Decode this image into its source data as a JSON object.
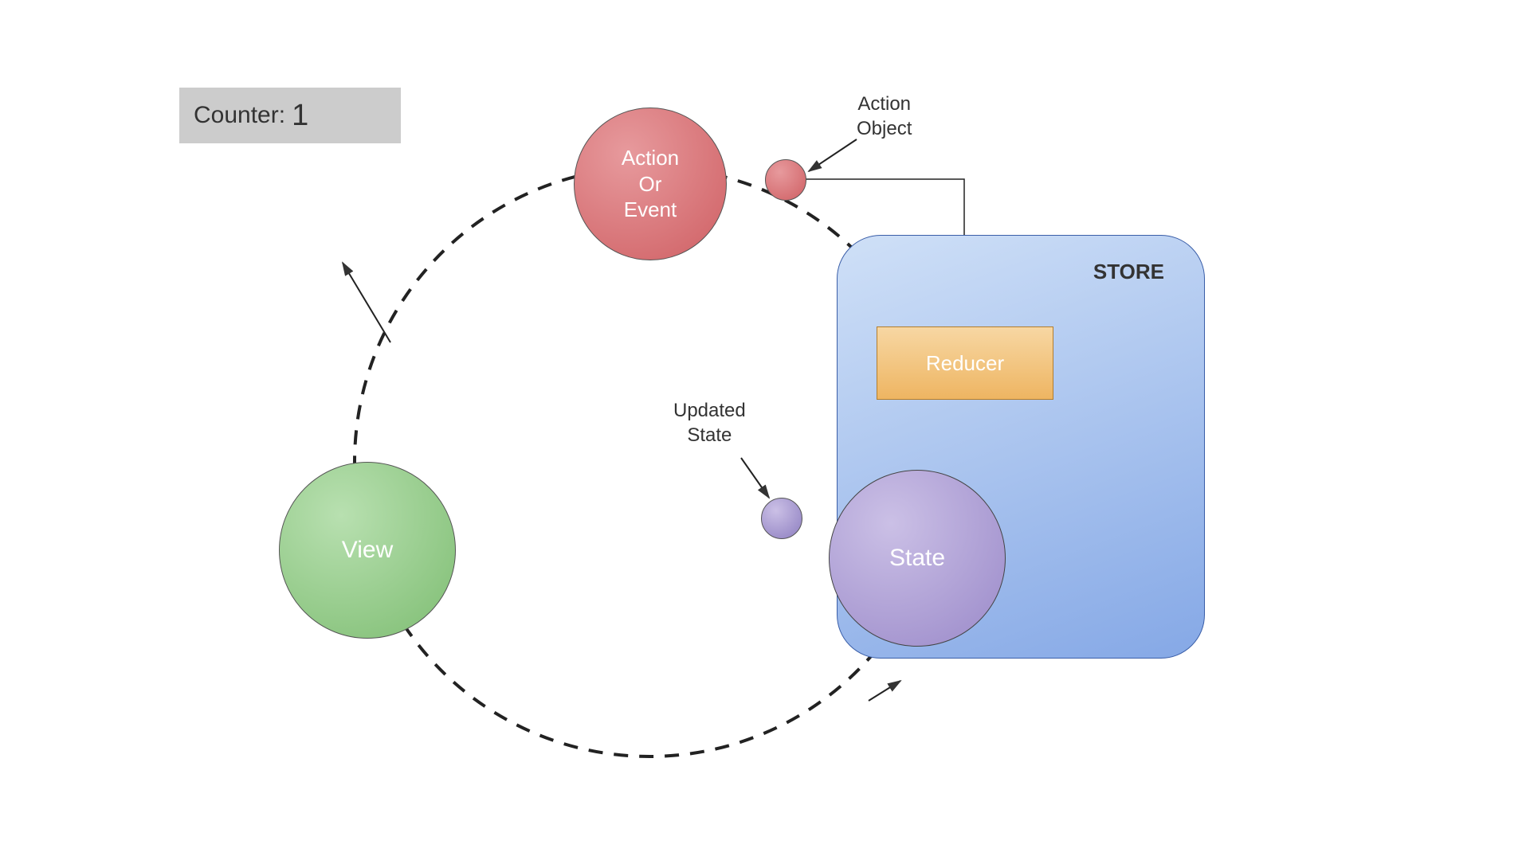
{
  "counter": {
    "label": "Counter:",
    "value": "1"
  },
  "nodes": {
    "action": "Action\nOr\nEvent",
    "view": "View",
    "state": "State",
    "reducer": "Reducer"
  },
  "store_title": "STORE",
  "annotations": {
    "action_object": "Action\nObject",
    "updated_state": "Updated\nState"
  }
}
